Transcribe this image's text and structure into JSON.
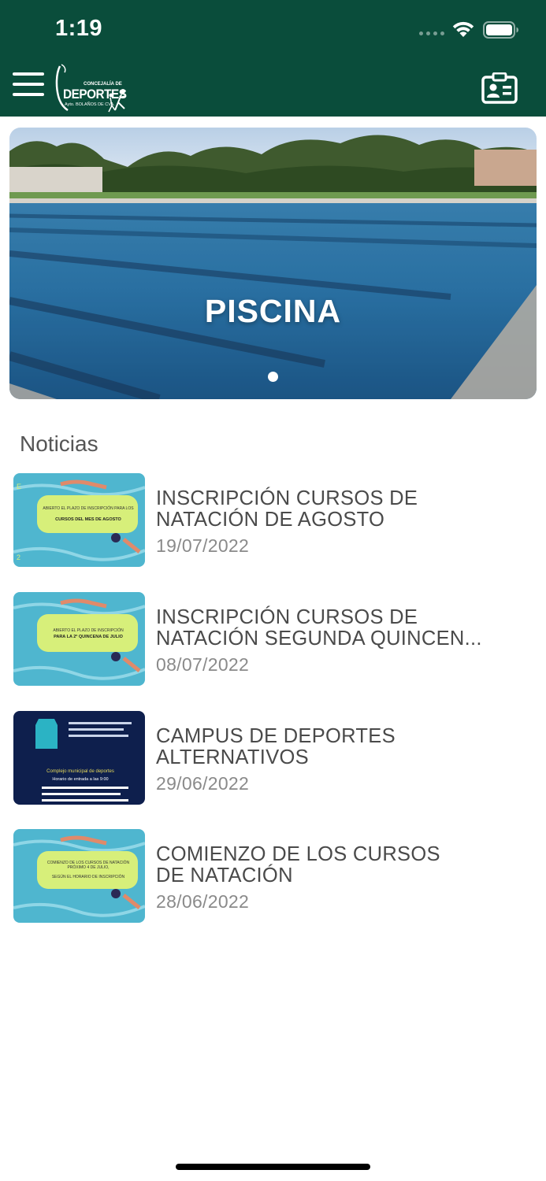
{
  "status_bar": {
    "time": "1:19"
  },
  "header": {
    "logo_line1": "CONCEJALÍA DE",
    "logo_title": "DEPORTES",
    "logo_line2": "Ayto. BOLAÑOS DE CVA."
  },
  "banner": {
    "title": "PISCINA",
    "active_slide": 1,
    "slide_count": 1
  },
  "news": {
    "section_title": "Noticias",
    "items": [
      {
        "title": "INSCRIPCIÓN CURSOS DE\nNATACIÓN DE AGOSTO",
        "date": "19/07/2022",
        "thumb_text1": "ABIERTO EL PLAZO DE INSCRIPCIÓN PARA LOS",
        "thumb_text2": "CURSOS DEL MES DE AGOSTO"
      },
      {
        "title": " INSCRIPCIÓN CURSOS DE\nNATACIÓN SEGUNDA QUINCEN...",
        "date": "08/07/2022",
        "thumb_text1": "ABIERTO EL PLAZO DE INSCRIPCIÓN",
        "thumb_text2": "PARA LA 2ª QUINCENA DE JULIO"
      },
      {
        "title": "CAMPUS DE DEPORTES\nALTERNATIVOS",
        "date": "29/06/2022",
        "thumb_text1": "Complejo municipal de deportes",
        "thumb_text2": "Horario de entrada a las 9:00"
      },
      {
        "title": "COMIENZO DE LOS CURSOS\nDE NATACIÓN",
        "date": "28/06/2022",
        "thumb_text1": "COMIENZO DE LOS CURSOS DE NATACIÓN PRÓXIMO 4 DE JULIO,",
        "thumb_text2": "SEGÚN EL HORARIO DE INSCRIPCIÓN"
      }
    ]
  },
  "colors": {
    "header_bg": "#0a4d3b",
    "text_primary": "#4a4a4a",
    "text_secondary": "#8a8a8a"
  }
}
